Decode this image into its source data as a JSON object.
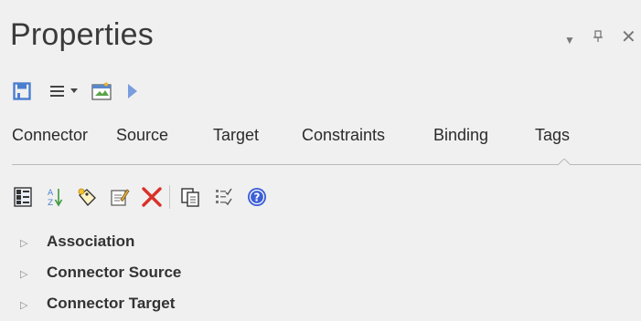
{
  "panel": {
    "title": "Properties",
    "controls": {
      "dropdown": "▼",
      "pin": "⊥",
      "close": "✕"
    }
  },
  "toolbar1": {
    "icons": [
      "save-icon",
      "menu-icon",
      "chevron-down-icon",
      "properties-window-icon",
      "play-icon"
    ]
  },
  "tabs": [
    {
      "label": "Connector"
    },
    {
      "label": "Source"
    },
    {
      "label": "Target"
    },
    {
      "label": "Constraints"
    },
    {
      "label": "Binding"
    },
    {
      "label": "Tags"
    }
  ],
  "active_tab": "Tags",
  "toolbar2": {
    "icons": [
      "categorized-view-icon",
      "sort-alpha-icon",
      "new-tag-icon",
      "edit-note-icon",
      "delete-icon",
      "copy-icon",
      "checklist-icon",
      "help-icon"
    ]
  },
  "tree": {
    "items": [
      {
        "label": "Association"
      },
      {
        "label": "Connector Source"
      },
      {
        "label": "Connector Target"
      }
    ]
  },
  "colors": {
    "accent_blue": "#4a7fd0",
    "delete_red": "#d8322a",
    "background": "#f0f0f0"
  }
}
